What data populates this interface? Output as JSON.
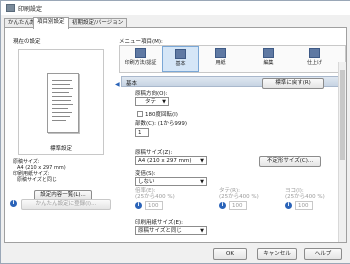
{
  "window": {
    "title": "印刷設定"
  },
  "tabs": [
    {
      "label": "かんたん設定"
    },
    {
      "label": "項目別設定"
    },
    {
      "label": "初期設定/バージョン"
    }
  ],
  "preview": {
    "section_label": "現在の設定",
    "mode_label": "標準設定",
    "details": [
      "原稿サイズ:",
      "A4 (210 x 297 mm)",
      "印刷用紙サイズ:",
      "原稿サイズと同じ"
    ],
    "list_button": "設定内容一覧(L)...",
    "register_button": "かんたん設定に登録(I)..."
  },
  "menu": {
    "label": "メニュー項目(M):",
    "items": [
      {
        "label": "印刷方法/認証",
        "icon": "printer-icon"
      },
      {
        "label": "基本",
        "icon": "page-icon"
      },
      {
        "label": "用紙",
        "icon": "paper-icon"
      },
      {
        "label": "編集",
        "icon": "edit-icon"
      },
      {
        "label": "仕上げ",
        "icon": "finish-icon"
      }
    ]
  },
  "settings": {
    "header": "基本",
    "reset_button": "標準に戻す(R)",
    "orientation": {
      "label": "原稿方向(O):",
      "value": "タテ"
    },
    "rotate": {
      "label": "180度回転(I)"
    },
    "copies": {
      "label": "部数(C): (1から999)",
      "value": "1"
    },
    "original_size": {
      "label": "原稿サイズ(Z):",
      "value": "A4 (210 x 297 mm)",
      "button": "不定形サイズ(C)..."
    },
    "zoom": {
      "label": "変倍(S):",
      "value": "しない"
    },
    "ratio": {
      "cols": [
        {
          "label": "倍率(E):",
          "range": "(25から400 %)",
          "value": "100"
        },
        {
          "label": "タテ(R):",
          "range": "(25から400 %)",
          "value": "100"
        },
        {
          "label": "ヨコ(I):",
          "range": "(25から400 %)",
          "value": "100"
        }
      ]
    },
    "print_size": {
      "label": "印刷用紙サイズ(E):",
      "value": "原稿サイズと同じ"
    }
  },
  "footer": {
    "ok": "OK",
    "cancel": "キャンセル",
    "help": "ヘルプ"
  },
  "colors": {
    "accent": "#2a63b8",
    "selected": "#d5e6f7",
    "header": "#c7d4e3"
  }
}
